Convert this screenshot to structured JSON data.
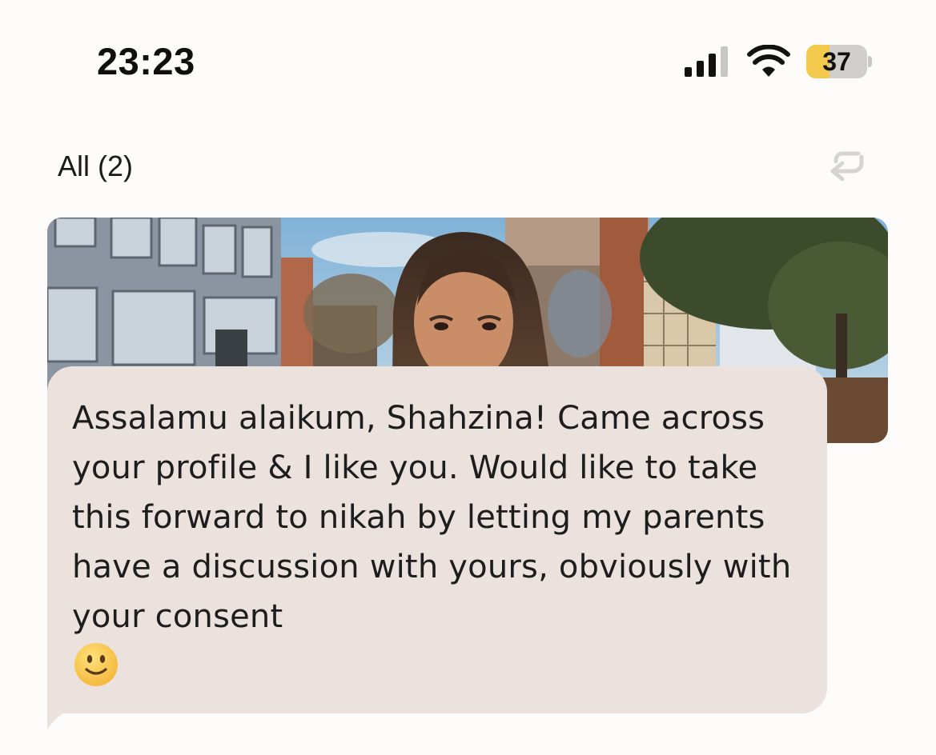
{
  "status_bar": {
    "time": "23:23",
    "battery_level": "37",
    "signal_bars": 3,
    "signal_icon": "cellular-signal-icon",
    "wifi_icon": "wifi-icon"
  },
  "header": {
    "filter_label": "All (2)",
    "reply_icon": "undo-reply-arrow-icon"
  },
  "profile_photo": {
    "subject": "woman-with-long-hair-city-street"
  },
  "message": {
    "text": "Assalamu alaikum, Shahzina! Came across your profile & I like you. Would like to take this forward to nikah by letting my parents have a discussion with yours, obviously with your consent",
    "emoji": "🙂",
    "bubble_color": "#ebe2de"
  },
  "colors": {
    "background": "#fdfcfb",
    "battery_fill": "#f2c94c"
  }
}
